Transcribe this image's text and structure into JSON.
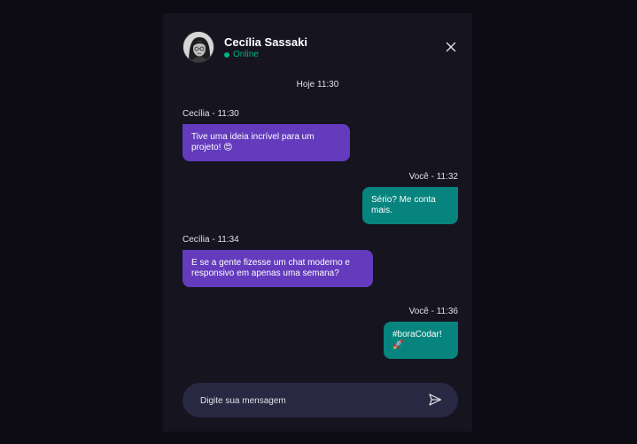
{
  "contact": {
    "name": "Cecília Sassaki",
    "status": "Online"
  },
  "day_label": "Hoje 11:30",
  "messages": [
    {
      "meta": "Cecília - 11:30",
      "text": "Tive uma ideia incrível para um projeto! 😍",
      "direction": "in"
    },
    {
      "meta": "Você - 11:32",
      "text": "Sério? Me conta mais.",
      "direction": "out"
    },
    {
      "meta": "Cecília - 11:34",
      "text": "E se a gente fizesse um chat moderno e responsivo em apenas uma semana?",
      "direction": "in"
    },
    {
      "meta": "Você - 11:36",
      "text": "#boraCodar! 🚀",
      "direction": "out"
    }
  ],
  "composer": {
    "placeholder": "Digite sua mensagem"
  },
  "colors": {
    "incoming_bubble": "#633bbc",
    "outgoing_bubble": "#07847e",
    "online": "#00b37e",
    "composer_bg": "#282843",
    "panel_bg": "#15141f"
  },
  "icons": {
    "close": "close-icon",
    "send": "send-icon",
    "status": "online-dot-icon"
  }
}
